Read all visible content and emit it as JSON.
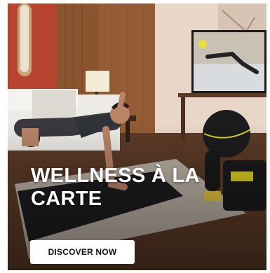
{
  "banner": {
    "headline": "WELLNESS À LA CARTE",
    "cta_label": "DISCOVER NOW",
    "image": "man-doing-plank-exercise-hotel-room-photo"
  },
  "colors": {
    "wall": "#ead9cc",
    "wood": "#7a4a2c",
    "floor": "#5e3a25",
    "mat": "#1f1f22",
    "rug": "#b9aea2",
    "tv_frame": "#1a1a1a",
    "accent_yellow": "#d9d21a",
    "cta_bg": "#ffffff",
    "cta_text": "#111111"
  }
}
